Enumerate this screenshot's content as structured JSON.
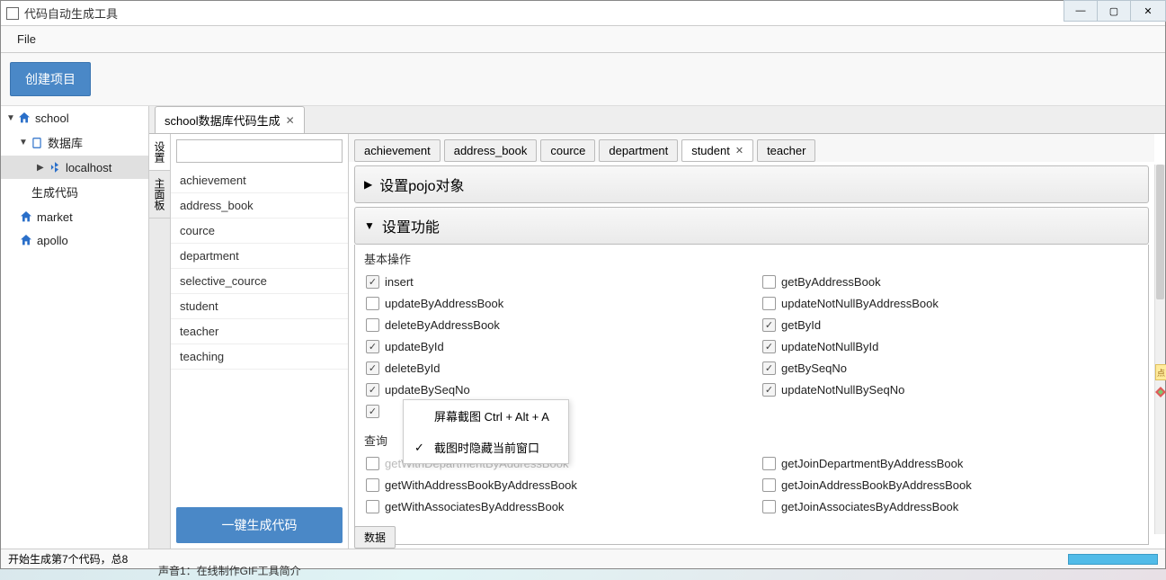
{
  "window": {
    "title": "代码自动生成工具",
    "controls": {
      "min": "—",
      "max": "▢",
      "close": "✕"
    }
  },
  "menu": {
    "file": "File"
  },
  "toolbar": {
    "create_project": "创建项目"
  },
  "tree": {
    "school": "school",
    "database": "数据库",
    "localhost": "localhost",
    "gen_code": "生成代码",
    "market": "market",
    "apollo": "apollo"
  },
  "doc_tab": {
    "label": "school数据库代码生成"
  },
  "vtabs": {
    "settings": "设置",
    "main_panel": "主面板"
  },
  "search": {
    "placeholder": ""
  },
  "tables": [
    "achievement",
    "address_book",
    "cource",
    "department",
    "selective_cource",
    "student",
    "teacher",
    "teaching"
  ],
  "gen_button": "一键生成代码",
  "dtabs": [
    "achievement",
    "address_book",
    "cource",
    "department",
    "student",
    "teacher"
  ],
  "dtabs_active": "student",
  "accordion": {
    "pojo": "设置pojo对象",
    "func": "设置功能"
  },
  "basic_ops_label": "基本操作",
  "basic_ops": [
    {
      "label": "insert",
      "checked": true
    },
    {
      "label": "getByAddressBook",
      "checked": false
    },
    {
      "label": "updateByAddressBook",
      "checked": false
    },
    {
      "label": "updateNotNullByAddressBook",
      "checked": false
    },
    {
      "label": "deleteByAddressBook",
      "checked": false
    },
    {
      "label": "getById",
      "checked": true
    },
    {
      "label": "updateById",
      "checked": true
    },
    {
      "label": "updateNotNullById",
      "checked": true
    },
    {
      "label": "deleteById",
      "checked": true
    },
    {
      "label": "getBySeqNo",
      "checked": true
    },
    {
      "label": "updateBySeqNo",
      "checked": true
    },
    {
      "label": "updateNotNullBySeqNo",
      "checked": true
    },
    {
      "label": "",
      "checked": true
    },
    {
      "label": "",
      "checked": false,
      "hidden": true
    }
  ],
  "query_label": "查询",
  "query_ops": [
    {
      "label": "getWithDepartmentByAddressBook",
      "checked": false,
      "obscured": true
    },
    {
      "label": "getJoinDepartmentByAddressBook",
      "checked": false
    },
    {
      "label": "getWithAddressBookByAddressBook",
      "checked": false
    },
    {
      "label": "getJoinAddressBookByAddressBook",
      "checked": false
    },
    {
      "label": "getWithAssociatesByAddressBook",
      "checked": false
    },
    {
      "label": "getJoinAssociatesByAddressBook",
      "checked": false
    }
  ],
  "bottom_pill": "数据",
  "context_menu": {
    "item1": "屏幕截图 Ctrl + Alt + A",
    "item2": "截图时隐藏当前窗口"
  },
  "status": "开始生成第7个代码，总8",
  "edge_label": "点",
  "crop_text": "声音1：在线制作GIF工具简介"
}
